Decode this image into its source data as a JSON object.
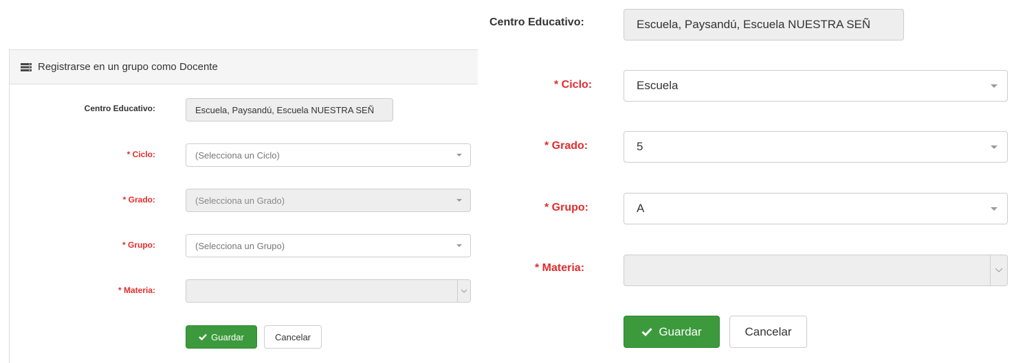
{
  "left": {
    "panel_title": "Registrarse en un grupo como Docente",
    "centro_label": "Centro Educativo:",
    "centro_value": "Escuela, Paysandú, Escuela NUESTRA SEÑ",
    "ciclo_label": "* Ciclo:",
    "ciclo_placeholder": "(Selecciona un Ciclo)",
    "grado_label": "* Grado:",
    "grado_placeholder": "(Selecciona un Grado)",
    "grupo_label": "* Grupo:",
    "grupo_placeholder": "(Selecciona un Grupo)",
    "materia_label": "* Materia:",
    "save_label": "Guardar",
    "cancel_label": "Cancelar"
  },
  "right": {
    "centro_label": "Centro Educativo:",
    "centro_value": "Escuela, Paysandú, Escuela NUESTRA SEÑ",
    "ciclo_label": "* Ciclo:",
    "ciclo_value": "Escuela",
    "grado_label": "* Grado:",
    "grado_value": "5",
    "grupo_label": "* Grupo:",
    "grupo_value": "A",
    "materia_label": "* Materia:",
    "save_label": "Guardar",
    "cancel_label": "Cancelar"
  },
  "colors": {
    "required_label": "#e32b2b",
    "success_button": "#3c9a3c",
    "panel_heading_bg": "#f5f5f5",
    "readonly_bg": "#eeeeee"
  },
  "icons": {
    "panel_icon": "server-stack-icon",
    "save_icon": "check-icon",
    "select_caret": "caret-down-icon"
  }
}
